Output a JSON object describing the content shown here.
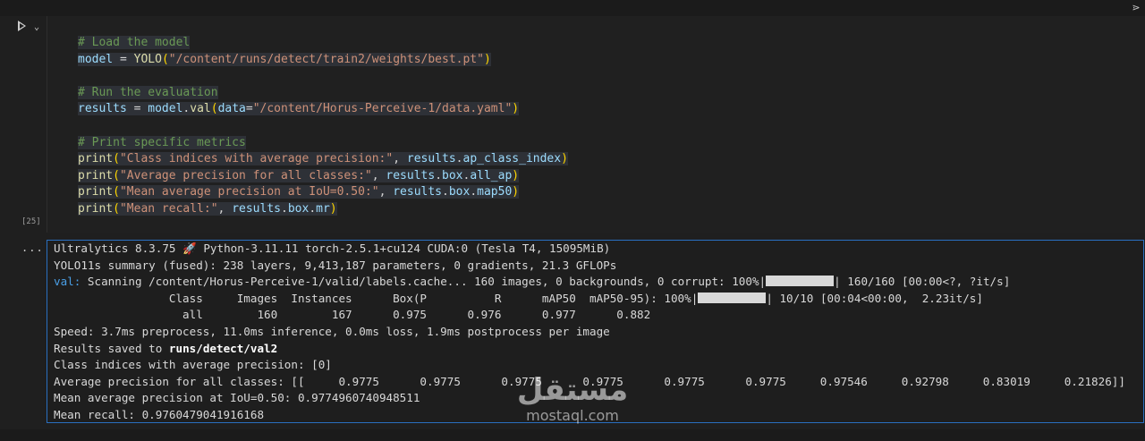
{
  "toolbar": {
    "corner_icon": "⋗"
  },
  "cell": {
    "execution_count": "[25]",
    "code": [
      [
        {
          "t": "# Load the model",
          "c": "cmt"
        }
      ],
      [
        {
          "t": "model",
          "c": "var"
        },
        {
          "t": " = ",
          "c": ""
        },
        {
          "t": "YOLO",
          "c": "fn"
        },
        {
          "t": "(",
          "c": "par"
        },
        {
          "t": "\"/content/runs/detect/train2/weights/best.pt\"",
          "c": "str"
        },
        {
          "t": ")",
          "c": "par"
        }
      ],
      [],
      [
        {
          "t": "# Run the evaluation",
          "c": "cmt"
        }
      ],
      [
        {
          "t": "results",
          "c": "var"
        },
        {
          "t": " = ",
          "c": ""
        },
        {
          "t": "model",
          "c": "var"
        },
        {
          "t": ".",
          "c": ""
        },
        {
          "t": "val",
          "c": "fn"
        },
        {
          "t": "(",
          "c": "par"
        },
        {
          "t": "data",
          "c": "var"
        },
        {
          "t": "=",
          "c": ""
        },
        {
          "t": "\"/content/Horus-Perceive-1/data.yaml\"",
          "c": "str"
        },
        {
          "t": ")",
          "c": "par"
        }
      ],
      [],
      [
        {
          "t": "# Print specific metrics",
          "c": "cmt"
        }
      ],
      [
        {
          "t": "print",
          "c": "fn"
        },
        {
          "t": "(",
          "c": "par"
        },
        {
          "t": "\"Class indices with average precision:\"",
          "c": "str"
        },
        {
          "t": ", ",
          "c": ""
        },
        {
          "t": "results",
          "c": "var"
        },
        {
          "t": ".",
          "c": ""
        },
        {
          "t": "ap_class_index",
          "c": "var"
        },
        {
          "t": ")",
          "c": "par"
        }
      ],
      [
        {
          "t": "print",
          "c": "fn"
        },
        {
          "t": "(",
          "c": "par"
        },
        {
          "t": "\"Average precision for all classes:\"",
          "c": "str"
        },
        {
          "t": ", ",
          "c": ""
        },
        {
          "t": "results",
          "c": "var"
        },
        {
          "t": ".",
          "c": ""
        },
        {
          "t": "box",
          "c": "var"
        },
        {
          "t": ".",
          "c": ""
        },
        {
          "t": "all_ap",
          "c": "var"
        },
        {
          "t": ")",
          "c": "par"
        }
      ],
      [
        {
          "t": "print",
          "c": "fn"
        },
        {
          "t": "(",
          "c": "par"
        },
        {
          "t": "\"Mean average precision at IoU=0.50:\"",
          "c": "str"
        },
        {
          "t": ", ",
          "c": ""
        },
        {
          "t": "results",
          "c": "var"
        },
        {
          "t": ".",
          "c": ""
        },
        {
          "t": "box",
          "c": "var"
        },
        {
          "t": ".",
          "c": ""
        },
        {
          "t": "map50",
          "c": "var"
        },
        {
          "t": ")",
          "c": "par"
        }
      ],
      [
        {
          "t": "print",
          "c": "fn"
        },
        {
          "t": "(",
          "c": "par"
        },
        {
          "t": "\"Mean recall:\"",
          "c": "str"
        },
        {
          "t": ", ",
          "c": ""
        },
        {
          "t": "results",
          "c": "var"
        },
        {
          "t": ".",
          "c": ""
        },
        {
          "t": "box",
          "c": "var"
        },
        {
          "t": ".",
          "c": ""
        },
        {
          "t": "mr",
          "c": "var"
        },
        {
          "t": ")",
          "c": "par"
        }
      ]
    ]
  },
  "output": {
    "dots": "...",
    "lines": [
      [
        {
          "t": "Ultralytics 8.3.75 ",
          "c": ""
        },
        {
          "t": "🚀",
          "c": "rocket"
        },
        {
          "t": " Python-3.11.11 torch-2.5.1+cu124 CUDA:0 (Tesla T4, 15095MiB)",
          "c": ""
        }
      ],
      [
        {
          "t": "YOLO11s summary (fused): 238 layers, 9,413,187 parameters, 0 gradients, 21.3 GFLOPs",
          "c": ""
        }
      ],
      [
        {
          "t": "val:",
          "c": "blue"
        },
        {
          "t": " Scanning /content/Horus-Perceive-1/valid/labels.cache... 160 images, 0 backgrounds, 0 corrupt: 100%|",
          "c": ""
        },
        {
          "bar": 76
        },
        {
          "t": "| 160/160 [00:00<?, ?it/s]",
          "c": ""
        }
      ],
      [
        {
          "t": "                 Class     Images  Instances      Box(P          R      mAP50  mAP50-95): 100%|",
          "c": ""
        },
        {
          "bar": 76
        },
        {
          "t": "| 10/10 [00:04<00:00,  2.23it/s]",
          "c": ""
        }
      ],
      [
        {
          "t": "                   all        160        167      0.975      0.976      0.977      0.882",
          "c": ""
        }
      ],
      [
        {
          "t": "Speed: 3.7ms preprocess, 11.0ms inference, 0.0ms loss, 1.9ms postprocess per image",
          "c": ""
        }
      ],
      [
        {
          "t": "Results saved to ",
          "c": ""
        },
        {
          "t": "runs/detect/val2",
          "c": "bold"
        }
      ],
      [
        {
          "t": "Class indices with average precision: [0]",
          "c": ""
        }
      ],
      [
        {
          "t": "Average precision for all classes: [[     0.9775      0.9775      0.9775      0.9775      0.9775      0.9775     0.97546     0.92798     0.83019     0.21826]]",
          "c": ""
        }
      ],
      [
        {
          "t": "Mean average precision at IoU=0.50: 0.9774960740948511",
          "c": ""
        }
      ],
      [
        {
          "t": "Mean recall: 0.9760479041916168",
          "c": ""
        }
      ]
    ]
  },
  "watermark": {
    "arabic": "مستقل",
    "latin": "mostaql.com"
  }
}
